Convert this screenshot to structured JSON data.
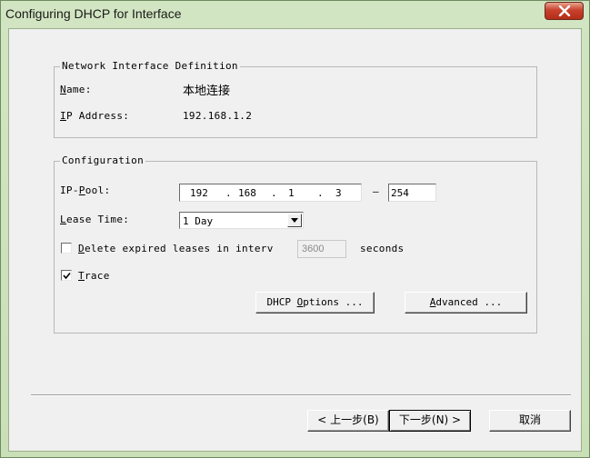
{
  "window": {
    "title": "Configuring DHCP for Interface"
  },
  "interface_group": {
    "legend": "Network Interface Definition",
    "name_label_u": "N",
    "name_label_rest": "ame:",
    "name_value": "本地连接",
    "ip_label_u": "I",
    "ip_label_rest": "P Address:",
    "ip_value": "192.168.1.2"
  },
  "config_group": {
    "legend": "Configuration",
    "pool_label_pre": "IP-",
    "pool_label_u": "P",
    "pool_label_rest": "ool:",
    "pool_octets": [
      "192",
      "168",
      "1",
      "3"
    ],
    "pool_dash": "–",
    "pool_end": "254",
    "lease_label_u": "L",
    "lease_label_rest": "ease Time:",
    "lease_value": "1 Day",
    "delete_checked": false,
    "delete_label_u": "D",
    "delete_label_rest": "elete expired leases in interv",
    "delete_interval": "3600",
    "delete_unit": "seconds",
    "trace_checked": true,
    "trace_label_u": "T",
    "trace_label_rest": "race",
    "dhcp_options_pre": "DHCP ",
    "dhcp_options_u": "O",
    "dhcp_options_rest": "ptions ...",
    "advanced_u": "A",
    "advanced_rest": "dvanced ..."
  },
  "footer": {
    "back_label": "< 上一步(B)",
    "next_label": "下一步(N) >",
    "cancel_label": "取消"
  }
}
